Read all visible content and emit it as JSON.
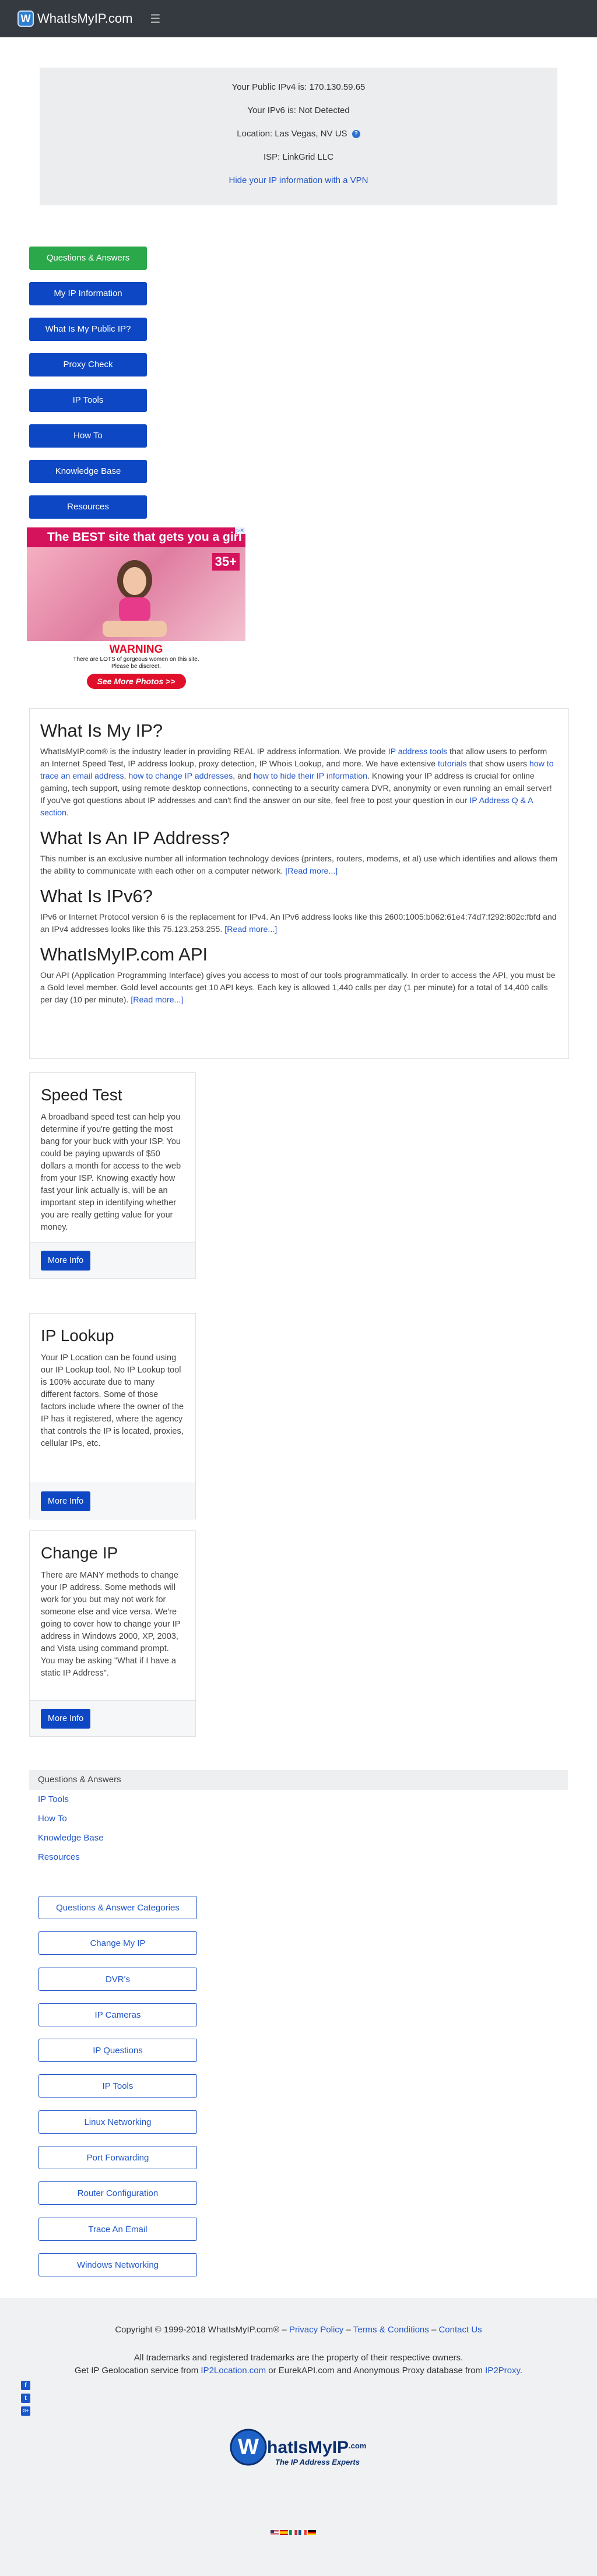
{
  "nav": {
    "brand": "WhatIsMyIP.com",
    "logo_letter": "W",
    "menu_icon": "hamburger-icon"
  },
  "ip_info": {
    "ipv4": "Your Public IPv4 is: 170.130.59.65",
    "ipv6": "Your IPv6 is: Not Detected",
    "location": "Location: Las Vegas, NV US",
    "isp": "ISP: LinkGrid LLC",
    "hide_link": "Hide your IP information with a VPN",
    "help_icon_text": "?"
  },
  "side_menu": [
    "Questions & Answers",
    "My IP Information",
    "What Is My Public IP?",
    "Proxy Check",
    "IP Tools",
    "How To",
    "Knowledge Base",
    "Resources"
  ],
  "ad": {
    "headline": "The BEST site that gets you a girl",
    "age": "35+",
    "warning": "WARNING",
    "sub1": "There are LOTS of gorgeous women on this site.",
    "sub2": "Please be discreet.",
    "button": "See More Photos >>"
  },
  "article": {
    "h1": "What Is My IP?",
    "p1_a": "WhatIsMyIP.com® is the industry leader in providing REAL IP address information. We provide ",
    "p1_link1": "IP address tools",
    "p1_b": " that allow users to perform an Internet Speed Test, IP address lookup, proxy detection, IP Whois Lookup, and more. We have extensive ",
    "p1_link2": "tutorials",
    "p1_c": " that show users ",
    "p1_link3": "how to trace an email address",
    "p1_d": ", ",
    "p1_link4": "how to change IP addresses",
    "p1_e": ", and ",
    "p1_link5": "how to hide their IP information",
    "p1_f": ". Knowing your IP address is crucial for online gaming, tech support, using remote desktop connections, connecting to a security camera DVR, anonymity or even running an email server! If you've got questions about IP addresses and can't find the answer on our site, feel free to post your question in our ",
    "p1_link6": "IP Address Q & A section",
    "p1_g": ".",
    "h2": "What Is An IP Address?",
    "p2": "This number is an exclusive number all information technology devices (printers, routers, modems, et al) use which identifies and allows them the ability to communicate with each other on a computer network. ",
    "h3": "What Is IPv6?",
    "p3": "IPv6 or Internet Protocol version 6 is the replacement for IPv4. An IPv6 address looks like this 2600:1005:b062:61e4:74d7:f292:802c:fbfd and an IPv4 addresses looks like this 75.123.253.255. ",
    "h4": "WhatIsMyIP.com API",
    "p4": "Our API (Application Programming Interface) gives you access to most of our tools programmatically. In order to access the API, you must be a Gold level member. Gold level accounts get 10 API keys. Each key is allowed 1,440 calls per day (1 per minute) for a total of 14,400 calls per day (10 per minute). ",
    "read_more": "[Read more...]"
  },
  "cards": [
    {
      "title": "Speed Test",
      "text": "A broadband speed test can help you determine if you're getting the most bang for your buck with your ISP. You could be paying upwards of $50 dollars a month for access to the web from your ISP. Knowing exactly how fast your link actually is, will be an important step in identifying whether you are really getting value for your money.",
      "button": "More Info"
    },
    {
      "title": "IP Lookup",
      "text": "Your IP Location can be found using our IP Lookup tool. No IP Lookup tool is 100% accurate due to many different factors. Some of those factors include where the owner of the IP has it registered, where the agency that controls the IP is located, proxies, cellular IPs, etc.",
      "button": "More Info"
    },
    {
      "title": "Change IP",
      "text": "There are MANY methods to change your IP address. Some methods will work for you but may not work for someone else and vice versa. We're going to cover how to change your IP address in Windows 2000, XP, 2003, and Vista using command prompt. You may be asking \"What if I have a static IP Address\".",
      "button": "More Info"
    }
  ],
  "footer_links": {
    "header": "Questions & Answers",
    "links": [
      "IP Tools",
      "How To",
      "Knowledge Base",
      "Resources"
    ]
  },
  "categories": [
    "Questions & Answer Categories",
    "Change My IP",
    "DVR's",
    "IP Cameras",
    "IP Questions",
    "IP Tools",
    "Linux Networking",
    "Port Forwarding",
    "Router Configuration",
    "Trace An Email",
    "Windows Networking"
  ],
  "site_footer": {
    "copy_a": "Copyright © 1999-2018 WhatIsMyIP.com® – ",
    "privacy": "Privacy Policy",
    "sep1": " – ",
    "terms": "Terms & Conditions",
    "sep2": " – ",
    "contact": "Contact Us",
    "rights": "All trademarks and registered trademarks are the property of their respective owners.",
    "geo_a": "Get IP Geolocation service from ",
    "geo_link1": "IP2Location.com",
    "geo_b": " or EurekAPI.com and Anonymous Proxy database from ",
    "geo_link2": "IP2Proxy",
    "geo_c": ".",
    "social": [
      "f",
      "t",
      "G+"
    ],
    "logo_text": "hatIsMyIP",
    "logo_suffix": ".com",
    "logo_letter": "W",
    "tagline": "The IP Address Experts",
    "flags": [
      "US",
      "ES",
      "IT",
      "FR",
      "DE"
    ]
  },
  "colors": {
    "navbar": "#343a40",
    "primary": "#0d47c4",
    "success": "#2aa84a",
    "link": "#2255cc"
  }
}
